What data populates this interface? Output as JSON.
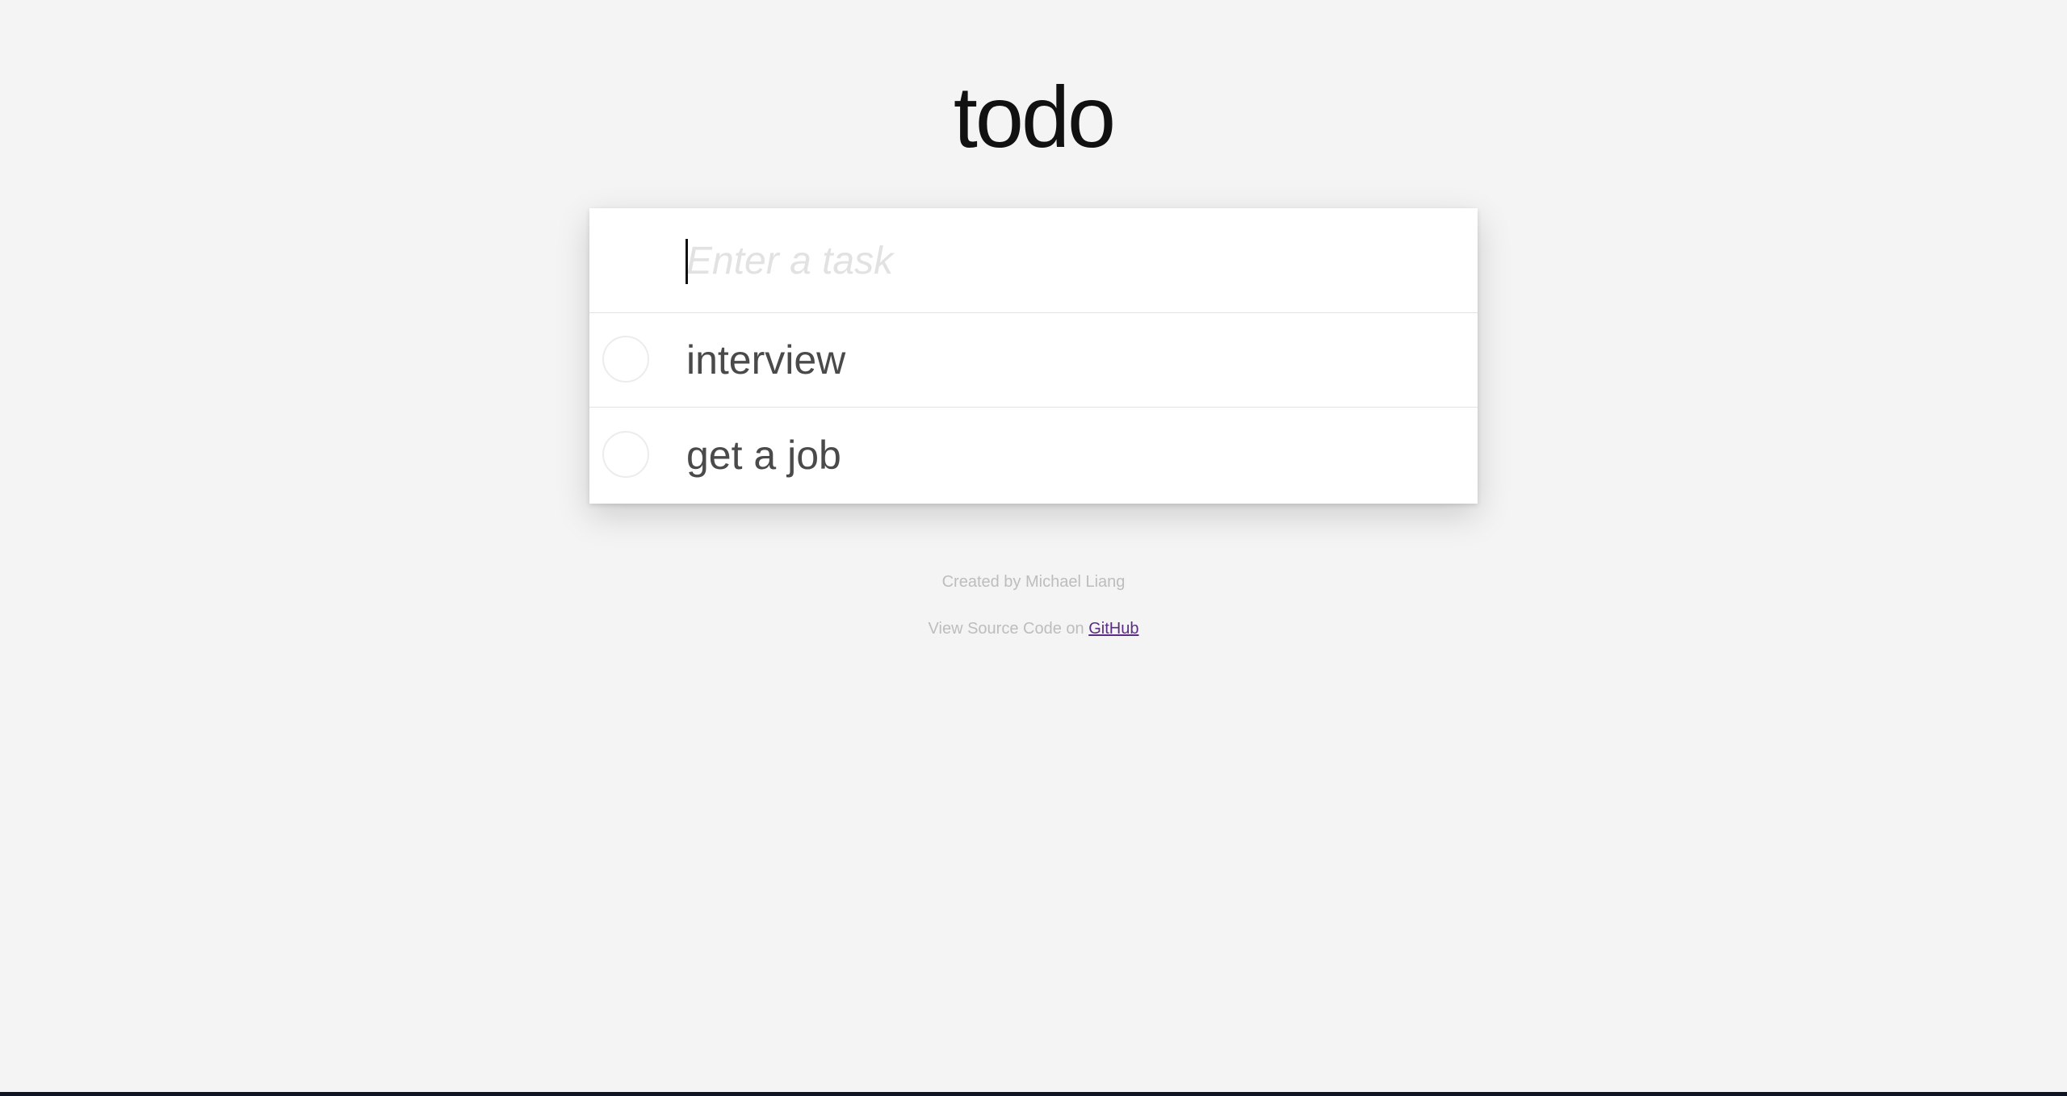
{
  "app": {
    "title": "todo"
  },
  "new_task": {
    "placeholder": "Enter a task",
    "value": ""
  },
  "todos": [
    {
      "label": "interview",
      "completed": false
    },
    {
      "label": "get a job",
      "completed": false
    }
  ],
  "footer": {
    "created_by": "Created by Michael Liang",
    "source_prefix": "View Source Code on ",
    "github_link": "GitHub"
  },
  "colors": {
    "background": "#f4f4f4",
    "card": "#ffffff",
    "link": "#5a2d82"
  }
}
